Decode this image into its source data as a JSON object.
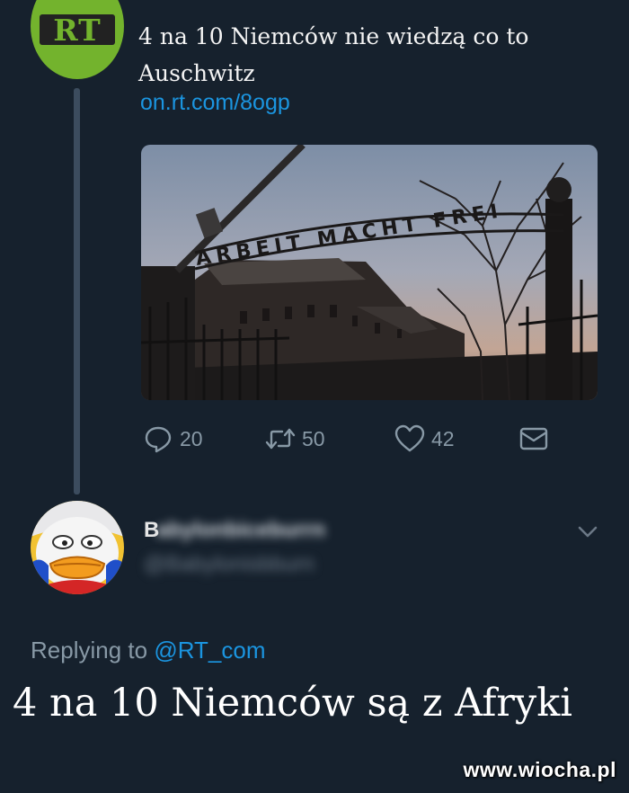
{
  "tweet": {
    "text": "4 na 10 Niemców nie wiedzą co to Auschwitz",
    "link": "on.rt.com/8ogp",
    "avatar_text": "RT",
    "image_sign_text": "ARBEIT MACHT FREI",
    "actions": {
      "reply_count": "20",
      "retweet_count": "50",
      "like_count": "42"
    }
  },
  "reply": {
    "name_first_letter": "B",
    "replying_prefix": "Replying to",
    "replying_handle": "@RT_com",
    "text": "4 na 10 Niemców są z Afryki"
  },
  "watermark": "www.wiocha.pl",
  "colors": {
    "background": "#16212d",
    "link": "#1b95e0",
    "muted": "#8899a6",
    "rt_green": "#73b32d",
    "thread_line": "#3c4c5e"
  },
  "icons": [
    "reply-icon",
    "retweet-icon",
    "like-icon",
    "direct-message-icon",
    "chevron-down-icon"
  ]
}
